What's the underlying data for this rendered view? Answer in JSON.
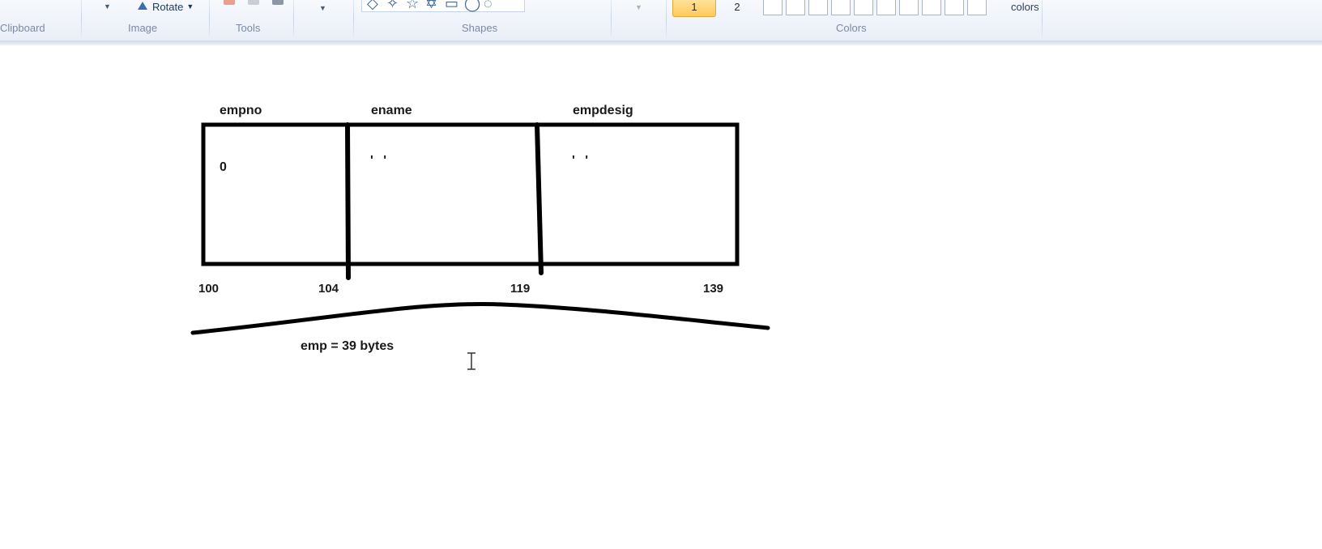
{
  "ribbon": {
    "groups": {
      "clipboard": "Clipboard",
      "image": "Image",
      "tools": "Tools",
      "shapes": "Shapes",
      "colors": "Colors"
    },
    "rotate_label": "Rotate",
    "color1_label": "1",
    "color2_label": "2",
    "edit_colors_label": "colors"
  },
  "diagram": {
    "fields": [
      {
        "label": "empno",
        "value": "0"
      },
      {
        "label": "ename",
        "value": "' '"
      },
      {
        "label": "empdesig",
        "value": "' '"
      }
    ],
    "addresses": [
      "100",
      "104",
      "119",
      "139"
    ],
    "size_label": "emp = 39 bytes"
  },
  "colors": {
    "active_color_bg": "#ffc95a",
    "ink": "#000000"
  }
}
